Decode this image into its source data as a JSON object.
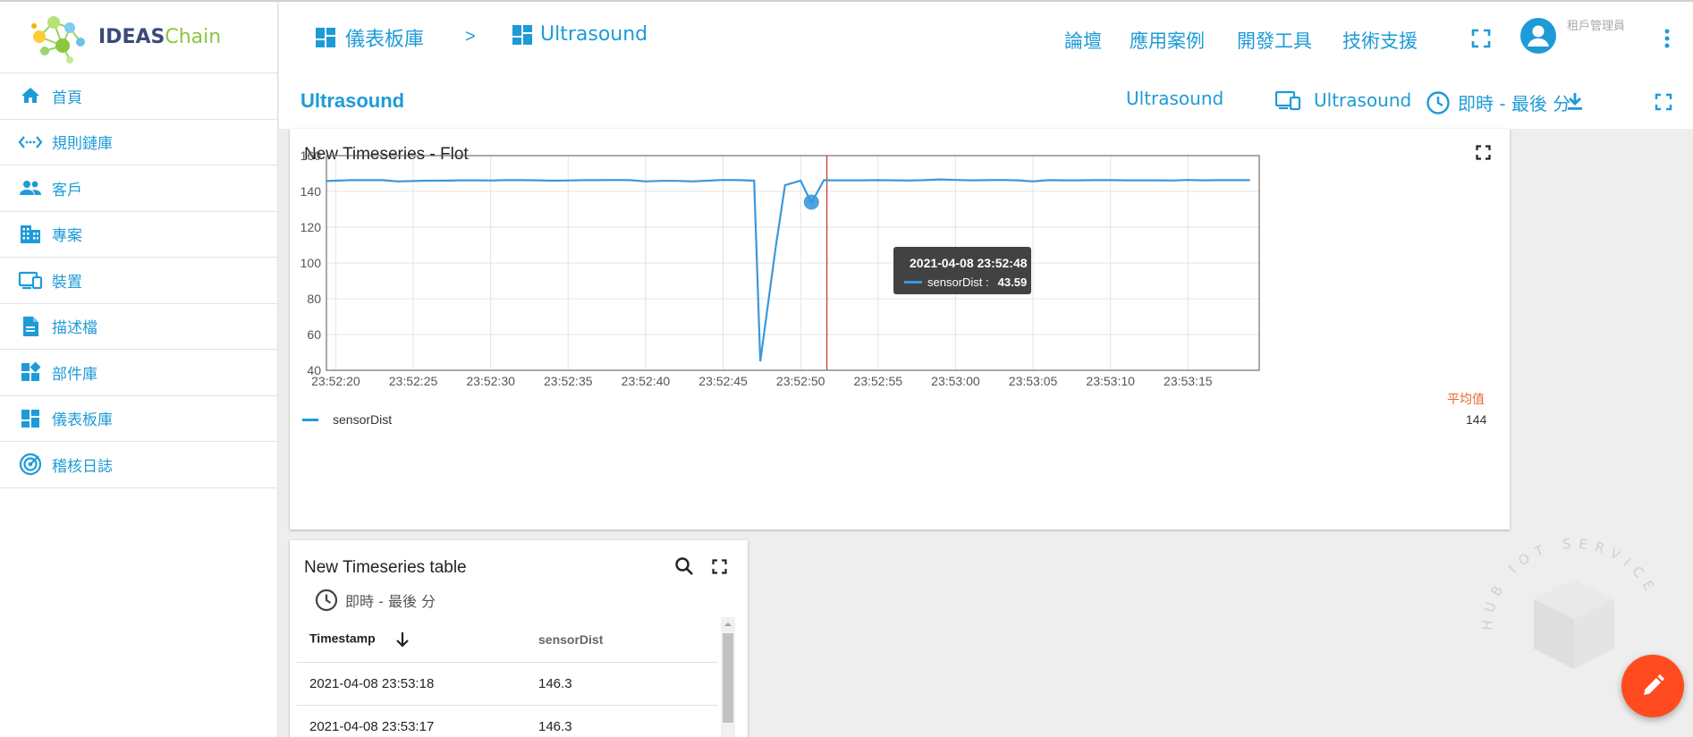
{
  "app": {
    "logo_ideas": "IDEAS",
    "logo_chain": "Chain"
  },
  "sidebar": {
    "items": [
      {
        "label": "首頁",
        "icon": "home-icon"
      },
      {
        "label": "規則鏈庫",
        "icon": "code-arrows-icon"
      },
      {
        "label": "客戶",
        "icon": "people-icon"
      },
      {
        "label": "專案",
        "icon": "building-icon"
      },
      {
        "label": "裝置",
        "icon": "devices-icon"
      },
      {
        "label": "描述檔",
        "icon": "document-icon"
      },
      {
        "label": "部件庫",
        "icon": "widgets-icon"
      },
      {
        "label": "儀表板庫",
        "icon": "dashboard-icon"
      },
      {
        "label": "稽核日誌",
        "icon": "audit-log-icon"
      }
    ]
  },
  "header": {
    "breadcrumb": [
      {
        "label": "儀表板庫"
      },
      {
        "label": "Ultrasound"
      }
    ],
    "breadcrumb_sep": ">",
    "links": [
      "論壇",
      "應用案例",
      "開發工具",
      "技術支援"
    ],
    "user_role": "租戶管理員"
  },
  "toolbar": {
    "title": "Ultrasound",
    "state": "Ultrasound",
    "entity": "Ultrasound",
    "timewindow": "即時 - 最後 分"
  },
  "flot": {
    "title": "New Timeseries - Flot",
    "legend_series": "sensorDist",
    "avg_label": "平均值",
    "avg_value": "144",
    "tooltip_time": "2021-04-08 23:52:48",
    "tooltip_series": "sensorDist :",
    "tooltip_value": "43.59"
  },
  "table": {
    "title": "New Timeseries table",
    "timewindow": "即時 - 最後 分",
    "col_timestamp": "Timestamp",
    "col_value": "sensorDist",
    "rows": [
      {
        "ts": "2021-04-08 23:53:18",
        "v": "146.3"
      },
      {
        "ts": "2021-04-08 23:53:17",
        "v": "146.3"
      }
    ]
  },
  "watermark": {
    "text": "HUB IOT SERVICE"
  },
  "colors": {
    "accent": "#1e9bd7",
    "line": "#3a98dc",
    "fab": "#ff4b1f",
    "avg": "#e8662c"
  },
  "chart_data": {
    "type": "line",
    "ylim": [
      40,
      160
    ],
    "y_ticks": [
      40,
      60,
      80,
      100,
      120,
      140,
      160
    ],
    "x_tick_labels": [
      "23:52:20",
      "23:52:25",
      "23:52:30",
      "23:52:35",
      "23:52:40",
      "23:52:45",
      "23:52:50",
      "23:52:55",
      "23:53:00",
      "23:53:05",
      "23:53:10",
      "23:53:15"
    ],
    "x_range_sec": [
      19.4,
      79.6
    ],
    "series": [
      {
        "name": "sensorDist",
        "x_sec": [
          19.4,
          21,
          22,
          23,
          24,
          25,
          26,
          27,
          28,
          29,
          30,
          31,
          32,
          33,
          34,
          35,
          36,
          37,
          38,
          39,
          40,
          41,
          42,
          43,
          44,
          45,
          46,
          47,
          47.4,
          48.4,
          49,
          50,
          50.7,
          51.5,
          52,
          53,
          54,
          55,
          56,
          57,
          58,
          59,
          60,
          61,
          62,
          63,
          64,
          65,
          66,
          67,
          68,
          69,
          70,
          71,
          72,
          73,
          74,
          75,
          76,
          77,
          78,
          79
        ],
        "values": [
          145.8,
          146.3,
          146.3,
          146.3,
          145.6,
          145.8,
          146,
          146,
          146.2,
          146.2,
          146.1,
          146.3,
          146.3,
          146.2,
          146,
          146.1,
          146.3,
          146.3,
          146.4,
          146.3,
          145.6,
          145.9,
          145.9,
          145.6,
          146,
          146.4,
          146.3,
          146,
          45,
          109,
          143.5,
          146,
          133.5,
          146.3,
          146.2,
          146.2,
          146.2,
          146.3,
          146.2,
          146.1,
          146.3,
          146.7,
          146.4,
          146.2,
          146.3,
          146.4,
          146.2,
          145.6,
          146.3,
          146.2,
          146.2,
          146.3,
          146.3,
          146.2,
          146.2,
          146.2,
          146.1,
          146.4,
          146.2,
          146.3,
          146.3,
          146.3
        ]
      }
    ],
    "hover_x_sec": 51.7,
    "hover_point": {
      "x_sec": 50.7,
      "y": 134
    }
  }
}
